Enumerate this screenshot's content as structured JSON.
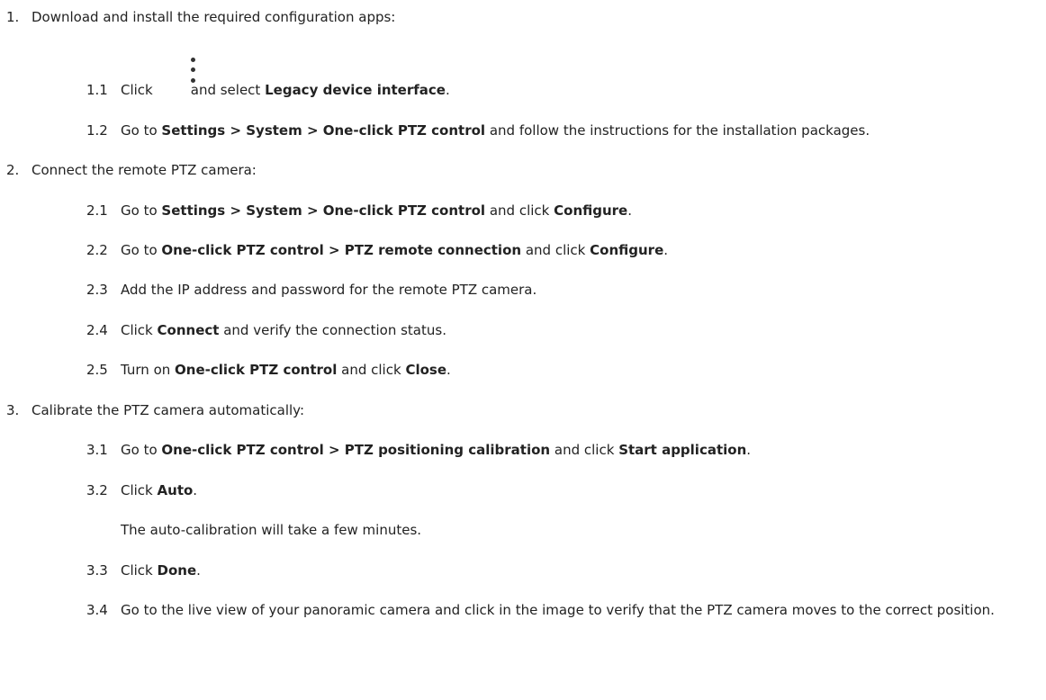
{
  "steps": [
    {
      "num": "1.",
      "text": "Download and install the required configuration apps:",
      "substeps": [
        {
          "num": "1.1",
          "a": "Click",
          "icon": "more-vertical-icon",
          "b": "and select",
          "c": "Legacy device interface",
          "d": "."
        },
        {
          "num": "1.2",
          "a": "Go to",
          "b": "Settings > System > One-click PTZ control",
          "c": "and follow the instructions for the installation packages."
        }
      ]
    },
    {
      "num": "2.",
      "text": "Connect the remote PTZ camera:",
      "substeps": [
        {
          "num": "2.1",
          "a": "Go to",
          "b": "Settings > System > One-click PTZ control",
          "c": "and click",
          "d": "Configure",
          "e": "."
        },
        {
          "num": "2.2",
          "a": "Go to",
          "b": "One-click PTZ control > PTZ remote connection",
          "c": "and click",
          "d": "Configure",
          "e": "."
        },
        {
          "num": "2.3",
          "a": "Add the IP address and password for the remote PTZ camera."
        },
        {
          "num": "2.4",
          "a": "Click",
          "b": "Connect",
          "c": "and verify the connection status."
        },
        {
          "num": "2.5",
          "a": "Turn on",
          "b": "One-click PTZ control",
          "c": "and click",
          "d": "Close",
          "e": "."
        }
      ]
    },
    {
      "num": "3.",
      "text": "Calibrate the PTZ camera automatically:",
      "substeps": [
        {
          "num": "3.1",
          "a": "Go to",
          "b": "One-click PTZ control > PTZ positioning calibration",
          "c": "and click",
          "d": "Start application",
          "e": "."
        },
        {
          "num": "3.2",
          "a": "Click",
          "b": "Auto",
          "c": ".",
          "note": "The auto-calibration will take a few minutes."
        },
        {
          "num": "3.3",
          "a": "Click",
          "b": "Done",
          "c": "."
        },
        {
          "num": "3.4",
          "a": "Go to the live view of your panoramic camera and click in the image to verify that the PTZ camera moves to the correct position."
        }
      ]
    }
  ]
}
